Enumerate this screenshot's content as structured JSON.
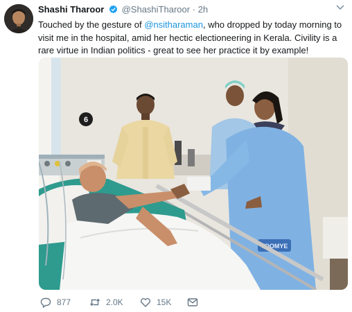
{
  "tweet": {
    "author_name": "Shashi Tharoor",
    "handle": "@ShashiTharoor",
    "separator": "·",
    "time": "2h",
    "text_before": "Touched by the gesture of ",
    "mention": "@nsitharaman",
    "text_after": ", who dropped by today morning to visit me in the hospital, amid her hectic electioneering in Kerala. Civility is a rare virtue in Indian politics - great to see her practice it by example!",
    "media_wall_number": "6",
    "media_tag_text": "TOOMYE"
  },
  "actions": {
    "reply_count": "877",
    "retweet_count": "2.0K",
    "like_count": "15K"
  },
  "colors": {
    "link": "#1b95e0",
    "meta": "#657786",
    "verified": "#1da1f2"
  },
  "icons": [
    "verified-badge-icon",
    "chevron-down-icon",
    "reply-icon",
    "retweet-icon",
    "like-icon",
    "message-icon"
  ]
}
